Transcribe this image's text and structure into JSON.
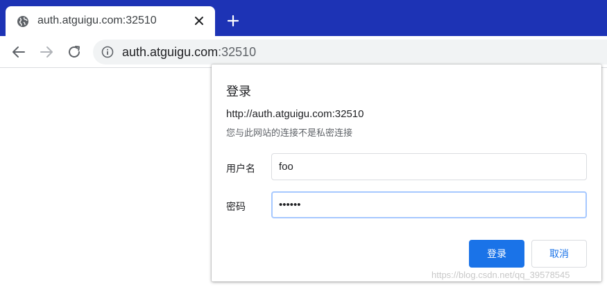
{
  "browser": {
    "tab": {
      "title": "auth.atguigu.com:32510",
      "icon": "globe-icon",
      "close_icon": "close-icon"
    },
    "new_tab_icon": "plus-icon",
    "toolbar": {
      "back_icon": "back-arrow-icon",
      "forward_icon": "forward-arrow-icon",
      "reload_icon": "reload-icon",
      "site_info_icon": "info-icon",
      "url_host": "auth.atguigu.com",
      "url_port": ":32510"
    },
    "colors": {
      "tabbar": "#1d33b5",
      "accent": "#1a73e8",
      "focus_border": "#a6c8ff"
    }
  },
  "auth_dialog": {
    "title": "登录",
    "origin": "http://auth.atguigu.com:32510",
    "warning": "您与此网站的连接不是私密连接",
    "username_label": "用户名",
    "username_value": "foo",
    "password_label": "密码",
    "password_value": "foobar",
    "submit_label": "登录",
    "cancel_label": "取消"
  },
  "watermark": "https://blog.csdn.net/qq_39578545"
}
